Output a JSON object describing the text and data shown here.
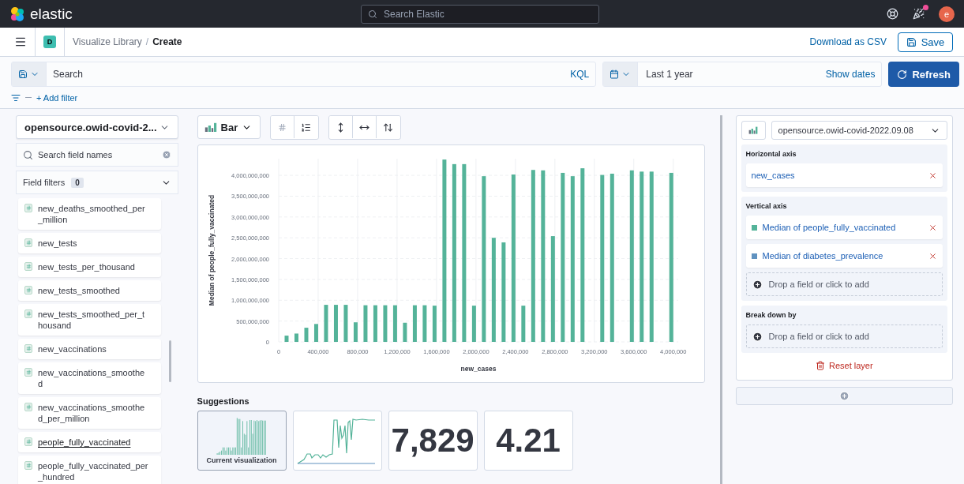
{
  "header": {
    "logo_text": "elastic",
    "search_placeholder": "Search Elastic",
    "newsfeed_unread": true,
    "avatar_initial": "e"
  },
  "nav": {
    "app_badge": "D",
    "breadcrumb_separator": "/",
    "breadcrumbs": [
      {
        "label": "Visualize Library",
        "current": false
      },
      {
        "label": "Create",
        "current": true
      }
    ],
    "download_link": "Download as CSV",
    "save_button": "Save"
  },
  "query_bar": {
    "search_placeholder": "Search",
    "language": "KQL",
    "date_range": "Last 1 year",
    "show_dates": "Show dates",
    "refresh_button": "Refresh"
  },
  "filters": {
    "add_filter": "+ Add filter"
  },
  "field_panel": {
    "index_pattern": "opensource.owid-covid-2...",
    "search_placeholder": "Search field names",
    "field_filters": {
      "label": "Field filters",
      "count": "0"
    },
    "fields": [
      {
        "name": "new_deaths_smoothed_per_million",
        "hovered": false
      },
      {
        "name": "new_tests",
        "hovered": false
      },
      {
        "name": "new_tests_per_thousand",
        "hovered": false
      },
      {
        "name": "new_tests_smoothed",
        "hovered": false
      },
      {
        "name": "new_tests_smoothed_per_thousand",
        "hovered": false
      },
      {
        "name": "new_vaccinations",
        "hovered": false
      },
      {
        "name": "new_vaccinations_smoothed",
        "hovered": false
      },
      {
        "name": "new_vaccinations_smoothed_per_million",
        "hovered": false
      },
      {
        "name": "people_fully_vaccinated",
        "hovered": true
      },
      {
        "name": "people_fully_vaccinated_per_hundred",
        "hovered": false
      }
    ]
  },
  "workspace": {
    "chart_type": "Bar",
    "chart": {
      "chart_data": {
        "type": "bar",
        "xlabel": "new_cases",
        "ylabel": "Median of people_fully_vaccinated",
        "x": [
          100000,
          200000,
          300000,
          400000,
          500000,
          600000,
          700000,
          800000,
          900000,
          1000000,
          1100000,
          1200000,
          1300000,
          1400000,
          1500000,
          1600000,
          1700000,
          1800000,
          1900000,
          2000000,
          2100000,
          2200000,
          2300000,
          2400000,
          2500000,
          2600000,
          2700000,
          2800000,
          2900000,
          3000000,
          3100000,
          3300000,
          3400000,
          3600000,
          3700000,
          3800000,
          4000000
        ],
        "grid": true,
        "series": [
          {
            "color": "#54b399",
            "values": [
              150000000,
              200000000,
              340000000,
              430000000,
              890000000,
              890000000,
              890000000,
              470000000,
              880000000,
              880000000,
              880000000,
              880000000,
              460000000,
              880000000,
              880000000,
              870000000,
              4380000000,
              4270000000,
              4270000000,
              870000000,
              3980000000,
              2500000000,
              2390000000,
              4020000000,
              870000000,
              4130000000,
              4120000000,
              2540000000,
              4060000000,
              3980000000,
              4170000000,
              4010000000,
              4040000000,
              4120000000,
              4090000000,
              4090000000,
              4060000000
            ]
          }
        ],
        "xlim": [
          0,
          4050000
        ],
        "ylim": [
          0,
          4400000000
        ],
        "xticks": [
          {
            "value": 0,
            "label": "0"
          },
          {
            "value": 400000,
            "label": "400,000"
          },
          {
            "value": 800000,
            "label": "800,000"
          },
          {
            "value": 1200000,
            "label": "1,200,000"
          },
          {
            "value": 1600000,
            "label": "1,600,000"
          },
          {
            "value": 2000000,
            "label": "2,000,000"
          },
          {
            "value": 2400000,
            "label": "2,400,000"
          },
          {
            "value": 2800000,
            "label": "2,800,000"
          },
          {
            "value": 3200000,
            "label": "3,200,000"
          },
          {
            "value": 3600000,
            "label": "3,600,000"
          },
          {
            "value": 4000000,
            "label": "4,000,000"
          }
        ],
        "yticks": [
          {
            "value": 0,
            "label": "0"
          },
          {
            "value": 500000000,
            "label": "500,000,000"
          },
          {
            "value": 1000000000,
            "label": "1,000,000,000"
          },
          {
            "value": 1500000000,
            "label": "1,500,000,000"
          },
          {
            "value": 2000000000,
            "label": "2,000,000,000"
          },
          {
            "value": 2500000000,
            "label": "2,500,000,000"
          },
          {
            "value": 3000000000,
            "label": "3,000,000,000"
          },
          {
            "value": 3500000000,
            "label": "3,500,000,000"
          },
          {
            "value": 4000000000,
            "label": "4,000,000,000"
          }
        ]
      }
    },
    "suggestions": {
      "title": "Suggestions",
      "items": [
        {
          "kind": "bar",
          "label": "Current visualization",
          "selected": true
        },
        {
          "kind": "line",
          "selected": false
        },
        {
          "kind": "metric",
          "value": "7,829",
          "selected": false
        },
        {
          "kind": "metric",
          "value": "4.21",
          "selected": false
        }
      ]
    }
  },
  "layer_panel": {
    "datasource": "opensource.owid-covid-2022.09.08",
    "sections": [
      {
        "title": "Horizontal axis",
        "fields": [
          {
            "label": "new_cases"
          }
        ]
      },
      {
        "title": "Vertical axis",
        "fields": [
          {
            "label": "Median of people_fully_vaccinated",
            "color": "#54b399"
          },
          {
            "label": "Median of diabetes_prevalence",
            "color": "#6092c0"
          }
        ],
        "drop_hint": "Drop a field or click to add"
      },
      {
        "title": "Break down by",
        "drop_hint": "Drop a field or click to add"
      }
    ],
    "reset": "Reset layer"
  }
}
